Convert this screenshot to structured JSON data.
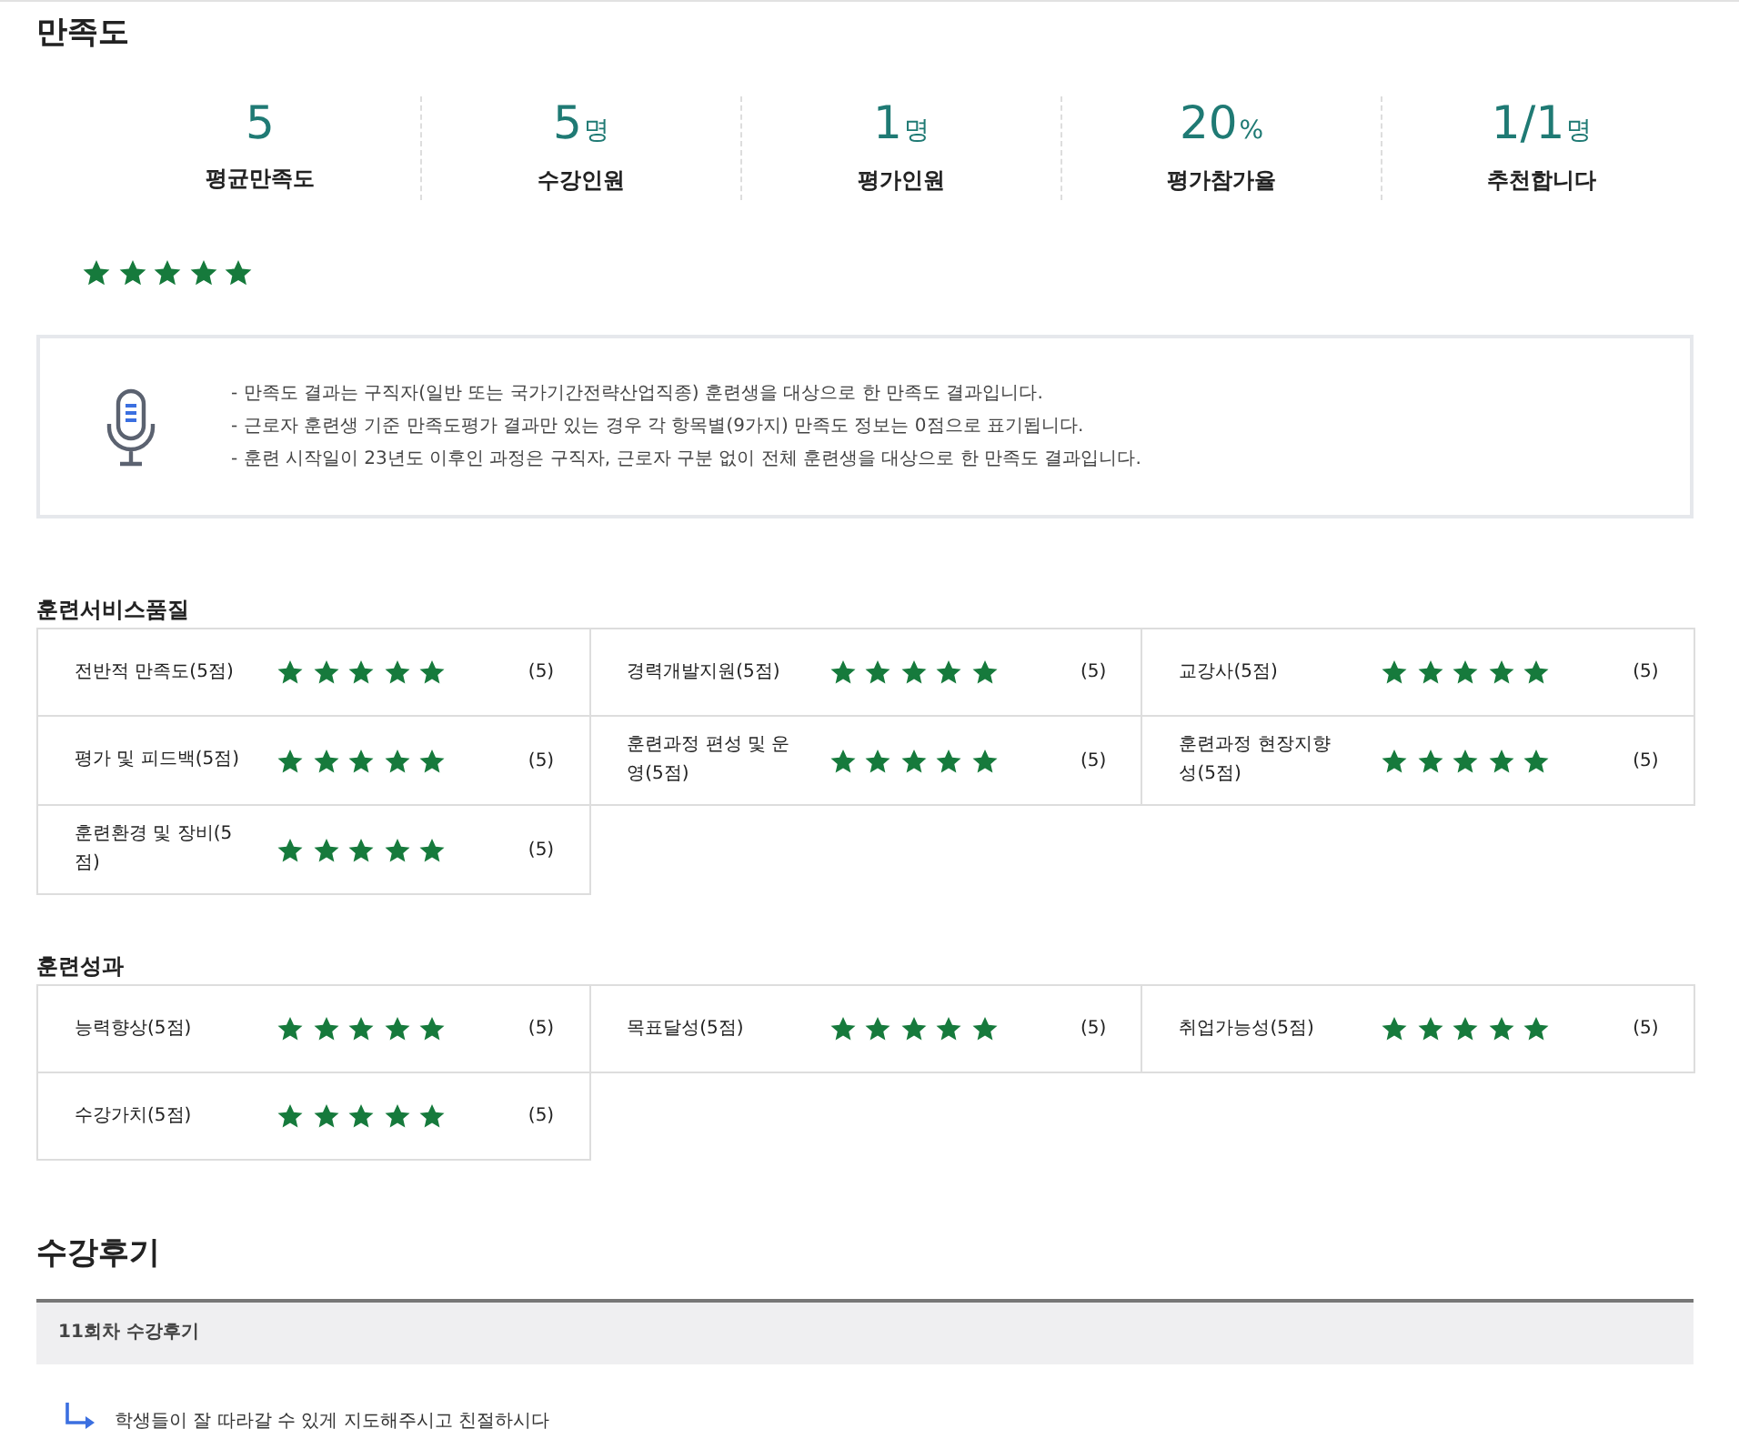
{
  "title": "만족도",
  "stats": [
    {
      "value": "5",
      "label": "평균만족도"
    },
    {
      "value": "5",
      "unit": "명",
      "label": "수강인원"
    },
    {
      "value": "1",
      "unit": "명",
      "label": "평가인원"
    },
    {
      "value": "20",
      "unit": "%",
      "label": "평가참가율"
    },
    {
      "value": "1/1",
      "unit": "명",
      "label": "추천합니다"
    }
  ],
  "overall": {
    "stars": 5
  },
  "notice": [
    "- 만족도 결과는 구직자(일반 또는 국가기간전략산업직종) 훈련생을 대상으로 한 만족도 결과입니다.",
    "- 근로자 훈련생 기준 만족도평가 결과만 있는 경우 각 항목별(9가지) 만족도 정보는 0점으로 표기됩니다.",
    "- 훈련 시작일이 23년도 이후인 과정은 구직자, 근로자 구분 없이 전체 훈련생을 대상으로 한 만족도 결과입니다."
  ],
  "sections": [
    {
      "title": "훈련서비스품질",
      "items": [
        {
          "label": "전반적 만족도(5점)",
          "stars": 5,
          "score": "(5)"
        },
        {
          "label": "경력개발지원(5점)",
          "stars": 5,
          "score": "(5)"
        },
        {
          "label": "교강사(5점)",
          "stars": 5,
          "score": "(5)"
        },
        {
          "label": "평가 및 피드백(5점)",
          "stars": 5,
          "score": "(5)"
        },
        {
          "label": "훈련과정 편성 및 운영(5점)",
          "stars": 5,
          "score": "(5)"
        },
        {
          "label": "훈련과정 현장지향성(5점)",
          "stars": 5,
          "score": "(5)"
        },
        {
          "label": "훈련환경 및 장비(5점)",
          "stars": 5,
          "score": "(5)"
        }
      ]
    },
    {
      "title": "훈련성과",
      "items": [
        {
          "label": "능력향상(5점)",
          "stars": 5,
          "score": "(5)"
        },
        {
          "label": "목표달성(5점)",
          "stars": 5,
          "score": "(5)"
        },
        {
          "label": "취업가능성(5점)",
          "stars": 5,
          "score": "(5)"
        },
        {
          "label": "수강가치(5점)",
          "stars": 5,
          "score": "(5)"
        }
      ]
    }
  ],
  "reviews": {
    "title": "수강후기",
    "items": [
      {
        "heading": "11회차 수강후기",
        "reply": "학생들이 잘 따라갈 수 있게 지도해주시고 친절하시다"
      }
    ]
  }
}
